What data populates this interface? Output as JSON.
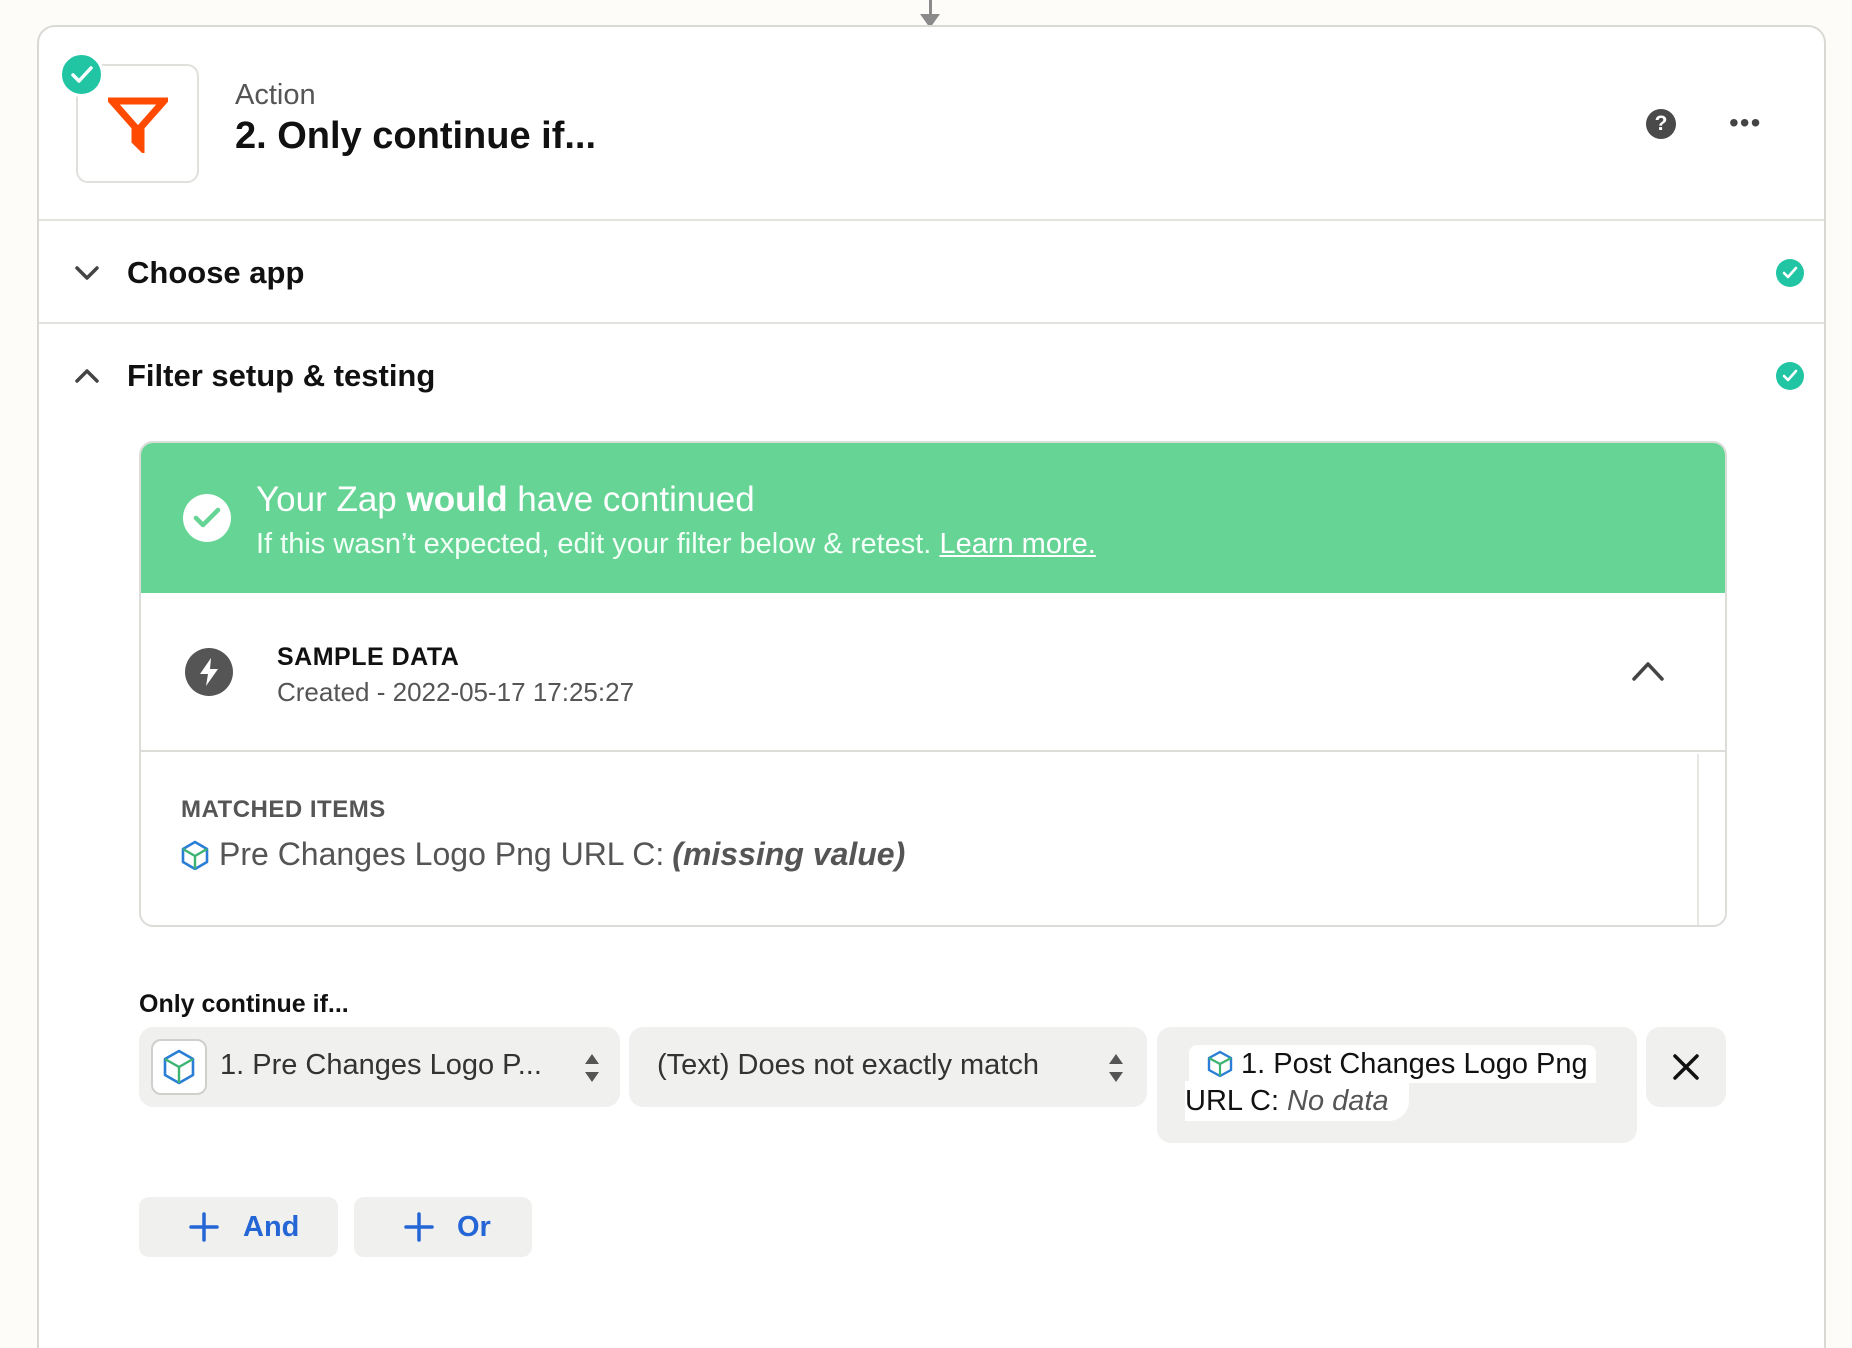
{
  "step": {
    "type": "Action",
    "title": "2. Only continue if..."
  },
  "sections": {
    "choose_app": "Choose app",
    "filter_setup": "Filter setup & testing"
  },
  "result": {
    "headline_pre": "Your Zap ",
    "headline_bold": "would",
    "headline_post": " have continued",
    "subtext": "If this wasn’t expected, edit your filter below & retest. ",
    "learn_more": "Learn more."
  },
  "sample_data": {
    "title": "SAMPLE DATA",
    "subtitle": "Created - 2022-05-17 17:25:27"
  },
  "matched": {
    "title": "MATCHED ITEMS",
    "item_label": "Pre Changes Logo Png URL C:",
    "item_value": "(missing value)"
  },
  "filter": {
    "label": "Only continue if...",
    "field": "1. Pre Changes Logo P...",
    "condition": "(Text) Does not exactly match",
    "value_line1": "1. Post Changes Logo Png",
    "value_line2": "URL C:",
    "value_nodata": "No data"
  },
  "buttons": {
    "and": "And",
    "or": "Or"
  },
  "icons": {
    "app": "filter-icon",
    "status": "check-circle-icon",
    "help": "help-icon",
    "more": "more-icon",
    "sample": "bolt-icon",
    "field": "cube-icon",
    "delete": "close-icon",
    "add": "plus-icon"
  },
  "colors": {
    "success": "#21c5a4",
    "banner": "#66d494",
    "filter_orange": "#ff4a00",
    "link_blue": "#2466d6"
  }
}
